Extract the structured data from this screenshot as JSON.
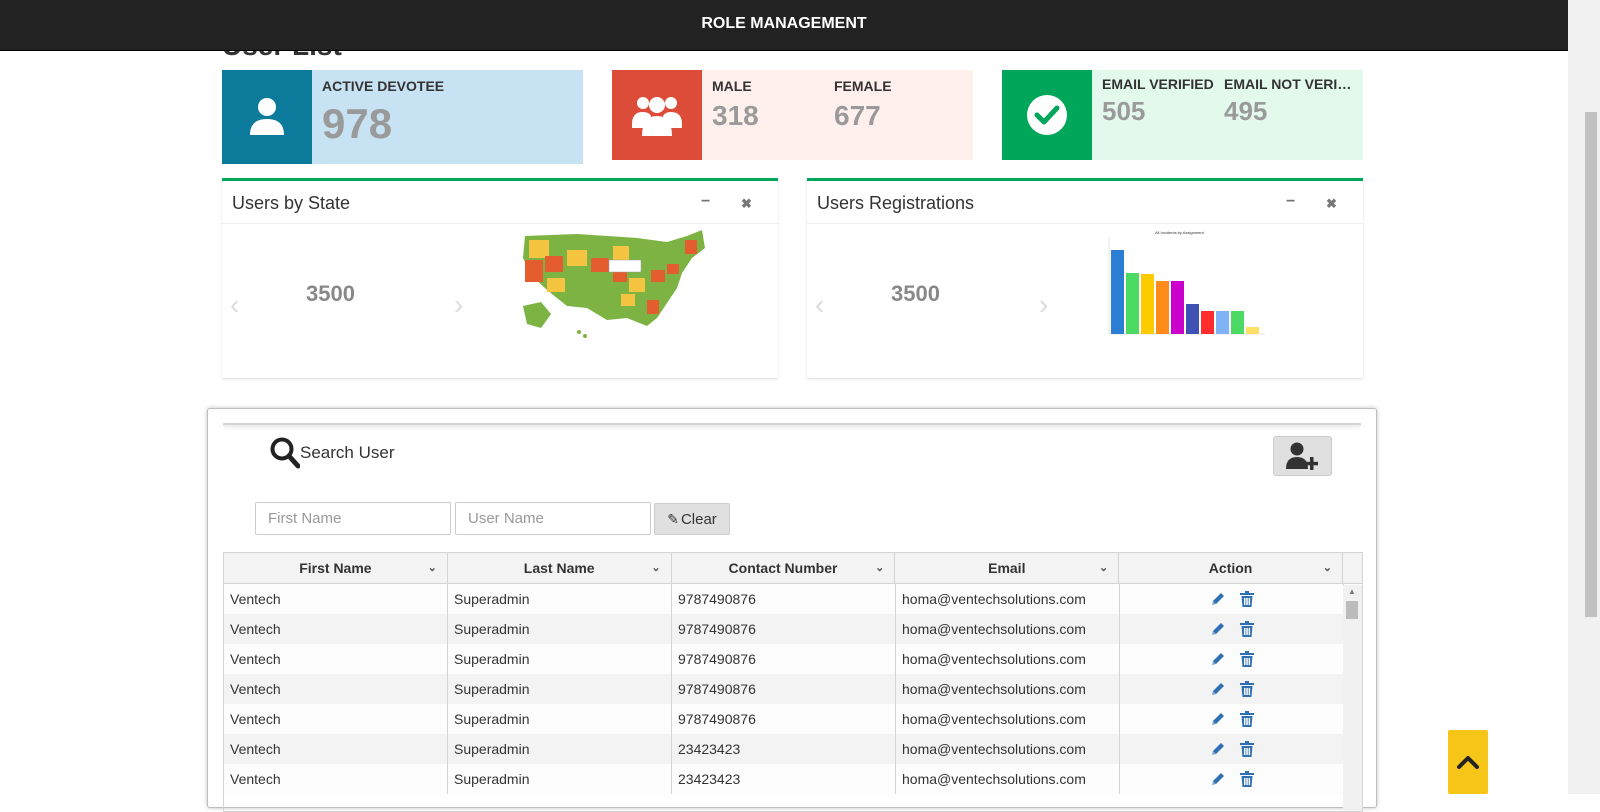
{
  "header": {
    "title": "ROLE MANAGEMENT"
  },
  "page": {
    "title_partial": "User List"
  },
  "stats": {
    "active": {
      "label": "ACTIVE DEVOTEE",
      "value": "978",
      "icon": "user-icon"
    },
    "gender": {
      "male_label": "MALE",
      "male_value": "318",
      "female_label": "FEMALE",
      "female_value": "677",
      "icon": "users-icon"
    },
    "email": {
      "verified_label": "EMAIL VERIFIED",
      "verified_value": "505",
      "not_verified_label": "EMAIL NOT VERIFIED",
      "not_verified_value": "495",
      "icon": "check-circle-icon"
    }
  },
  "widgets": {
    "state": {
      "title": "Users by State",
      "value": "3500",
      "minimize": "−",
      "close": "✖",
      "chart_title": ""
    },
    "registrations": {
      "title": "Users Registrations",
      "value": "3500",
      "minimize": "−",
      "close": "✖",
      "chart_title": "All Incidents by Assignment"
    }
  },
  "search": {
    "title": "Search User",
    "first_name_placeholder": "First Name",
    "user_name_placeholder": "User Name",
    "clear_label": "Clear",
    "clear_icon": "eraser-icon",
    "add_user_icon": "user-plus-icon"
  },
  "table": {
    "columns": [
      "First Name",
      "Last Name",
      "Contact Number",
      "Email",
      "Action"
    ],
    "rows": [
      {
        "first": "Ventech",
        "last": "Superadmin",
        "contact": "9787490876",
        "email": "homa@ventechsolutions.com"
      },
      {
        "first": "Ventech",
        "last": "Superadmin",
        "contact": "9787490876",
        "email": "homa@ventechsolutions.com"
      },
      {
        "first": "Ventech",
        "last": "Superadmin",
        "contact": "9787490876",
        "email": "homa@ventechsolutions.com"
      },
      {
        "first": "Ventech",
        "last": "Superadmin",
        "contact": "9787490876",
        "email": "homa@ventechsolutions.com"
      },
      {
        "first": "Ventech",
        "last": "Superadmin",
        "contact": "9787490876",
        "email": "homa@ventechsolutions.com"
      },
      {
        "first": "Ventech",
        "last": "Superadmin",
        "contact": "23423423",
        "email": "homa@ventechsolutions.com"
      },
      {
        "first": "Ventech",
        "last": "Superadmin",
        "contact": "23423423",
        "email": "homa@ventechsolutions.com"
      }
    ]
  },
  "colors": {
    "topbar": "#222222",
    "blue": "#0c7b9b",
    "red": "#dd4b39",
    "green": "#00a65a",
    "accent_yellow": "#f5c518",
    "action_blue": "#2f6fb3"
  }
}
